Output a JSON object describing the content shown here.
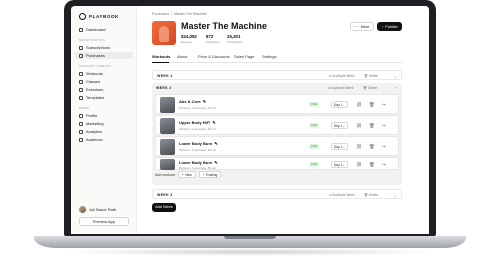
{
  "app": {
    "logo_text": "PLAYBOOK"
  },
  "sidebar": {
    "dashboard": "Dashboard",
    "section_monetization": "MONETIZATION",
    "subscriptions": "Subscriptions",
    "purchases": "Purchases",
    "section_content": "CONTENT LIBRARY",
    "workouts": "Workouts",
    "classes": "Classes",
    "exercises": "Exercises",
    "templates": "Templates",
    "section_more": "MORE",
    "profile": "Profile",
    "marketing": "Marketing",
    "analytics": "Analytics",
    "audience": "Audience",
    "user_name": "Juli Bauer Roth",
    "preview_app": "Preview App"
  },
  "breadcrumb": {
    "parent": "Purchases",
    "sep": "/",
    "current": "Master The Machine"
  },
  "program": {
    "title": "Master The Machine",
    "stats": [
      {
        "value": "$24,092",
        "label": "Revenue"
      },
      {
        "value": "872",
        "label": "Purchases"
      },
      {
        "value": "25,301",
        "label": "Completions"
      }
    ],
    "more": "More",
    "publish": "Publish"
  },
  "tabs": [
    "Workouts",
    "About",
    "Price & Discounts",
    "Sales Page",
    "Settings"
  ],
  "weeks": {
    "duplicate": "Duplicate Week",
    "delete": "Delete",
    "week1": "WEEK 1",
    "week2": "WEEK 2",
    "week3": "WEEK 3"
  },
  "workouts": [
    {
      "name": "Abs & Core",
      "meta": "Workout • 4 exercises, 45 min",
      "status": "LIVE",
      "day": "Day 1"
    },
    {
      "name": "Upper Body HIIT",
      "meta": "Workout • 4 exercises, 45 min",
      "status": "LIVE",
      "day": "Day 1"
    },
    {
      "name": "Lower Body Burn",
      "meta": "Workout • 4 exercises, 45 min",
      "status": "LIVE",
      "day": "Day 1"
    },
    {
      "name": "Lower Body Burn",
      "meta": "Workout • 4 exercises, 45 min",
      "status": "LIVE",
      "day": "Day 1"
    }
  ],
  "add": {
    "label": "Add workout",
    "new": "New",
    "existing": "Existing"
  },
  "add_week": "Add Week"
}
